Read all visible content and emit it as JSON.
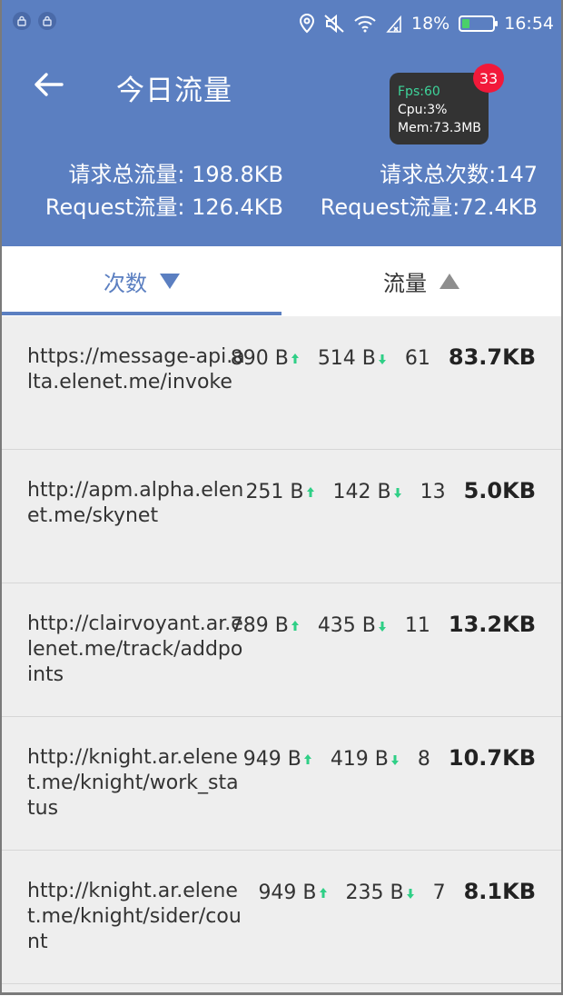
{
  "statusbar": {
    "battery": "18%",
    "battery_level": 0.18,
    "time": "16:54",
    "icons": [
      "lock-icon",
      "lock-icon",
      "location-icon",
      "mute-icon",
      "wifi-icon",
      "signal-icon",
      "battery-icon"
    ]
  },
  "header": {
    "title": "今日流量",
    "total_traffic": "请求总流量: 198.8KB",
    "total_count": "请求总次数:147",
    "request_left": "Request流量: 126.4KB",
    "request_right": "Request流量:72.4KB",
    "back_icon": "arrow-left-icon",
    "bg_color": "#5b7fc1"
  },
  "perf": {
    "fps": "Fps:60",
    "cpu": "Cpu:3%",
    "mem": "Mem:73.3MB",
    "badge": "33"
  },
  "tabs": {
    "count_label": "次数",
    "traffic_label": "流量",
    "active_color": "#5b7fc1"
  },
  "rows": [
    {
      "url": "https://message-api.alta.elenet.me/invoke",
      "up": "890 B",
      "down": "514 B",
      "count": "61",
      "total": "83.7KB"
    },
    {
      "url": "http://apm.alpha.elenet.me/skynet",
      "up": "251 B",
      "down": "142 B",
      "count": "13",
      "total": "5.0KB"
    },
    {
      "url": "http://clairvoyant.ar.elenet.me/track/addpoints",
      "up": "789 B",
      "down": "435 B",
      "count": "11",
      "total": "13.2KB"
    },
    {
      "url": "http://knight.ar.elenet.me/knight/work_status",
      "up": "949 B",
      "down": "419 B",
      "count": "8",
      "total": "10.7KB"
    },
    {
      "url": "http://knight.ar.elenet.me/knight/sider/count",
      "up": "949 B",
      "down": "235 B",
      "count": "7",
      "total": "8.1KB"
    }
  ]
}
